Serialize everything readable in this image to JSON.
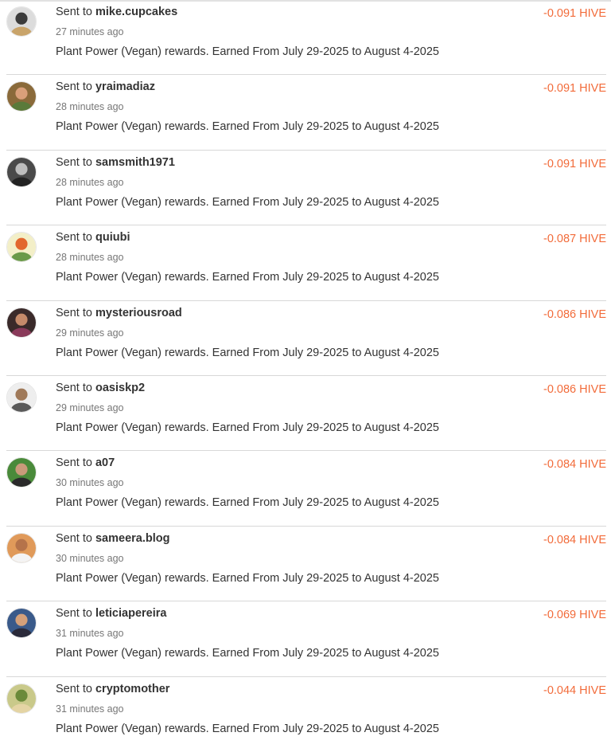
{
  "transactions": [
    {
      "sent_prefix": "Sent to",
      "recipient": "mike.cupcakes",
      "time_ago": "27 minutes ago",
      "memo": "Plant Power (Vegan) rewards. Earned From July 29-2025 to August 4-2025",
      "amount": "-0.091 HIVE",
      "avatar_colors": [
        "#dcdcdc",
        "#3b3b3b",
        "#c9a46a"
      ]
    },
    {
      "sent_prefix": "Sent to",
      "recipient": "yraimadiaz",
      "time_ago": "28 minutes ago",
      "memo": "Plant Power (Vegan) rewards. Earned From July 29-2025 to August 4-2025",
      "amount": "-0.091 HIVE",
      "avatar_colors": [
        "#8a6a3a",
        "#d9a07a",
        "#5a7a3a"
      ]
    },
    {
      "sent_prefix": "Sent to",
      "recipient": "samsmith1971",
      "time_ago": "28 minutes ago",
      "memo": "Plant Power (Vegan) rewards. Earned From July 29-2025 to August 4-2025",
      "amount": "-0.091 HIVE",
      "avatar_colors": [
        "#4a4a4a",
        "#bdbdbd",
        "#222222"
      ]
    },
    {
      "sent_prefix": "Sent to",
      "recipient": "quiubi",
      "time_ago": "28 minutes ago",
      "memo": "Plant Power (Vegan) rewards. Earned From July 29-2025 to August 4-2025",
      "amount": "-0.087 HIVE",
      "avatar_colors": [
        "#f3efc8",
        "#e2672e",
        "#6a9a4a"
      ]
    },
    {
      "sent_prefix": "Sent to",
      "recipient": "mysteriousroad",
      "time_ago": "29 minutes ago",
      "memo": "Plant Power (Vegan) rewards. Earned From July 29-2025 to August 4-2025",
      "amount": "-0.086 HIVE",
      "avatar_colors": [
        "#3a2a2a",
        "#c58a6a",
        "#8a3a5a"
      ]
    },
    {
      "sent_prefix": "Sent to",
      "recipient": "oasiskp2",
      "time_ago": "29 minutes ago",
      "memo": "Plant Power (Vegan) rewards. Earned From July 29-2025 to August 4-2025",
      "amount": "-0.086 HIVE",
      "avatar_colors": [
        "#eeeeee",
        "#a07a5a",
        "#5a5a5a"
      ]
    },
    {
      "sent_prefix": "Sent to",
      "recipient": "a07",
      "time_ago": "30 minutes ago",
      "memo": "Plant Power (Vegan) rewards. Earned From July 29-2025 to August 4-2025",
      "amount": "-0.084 HIVE",
      "avatar_colors": [
        "#4a8a3a",
        "#c99a7a",
        "#2a2a2a"
      ]
    },
    {
      "sent_prefix": "Sent to",
      "recipient": "sameera.blog",
      "time_ago": "30 minutes ago",
      "memo": "Plant Power (Vegan) rewards. Earned From July 29-2025 to August 4-2025",
      "amount": "-0.084 HIVE",
      "avatar_colors": [
        "#e09a5a",
        "#b5734a",
        "#f4f4f4"
      ]
    },
    {
      "sent_prefix": "Sent to",
      "recipient": "leticiapereira",
      "time_ago": "31 minutes ago",
      "memo": "Plant Power (Vegan) rewards. Earned From July 29-2025 to August 4-2025",
      "amount": "-0.069 HIVE",
      "avatar_colors": [
        "#3a5a8a",
        "#d4a07a",
        "#2a2a3a"
      ]
    },
    {
      "sent_prefix": "Sent to",
      "recipient": "cryptomother",
      "time_ago": "31 minutes ago",
      "memo": "Plant Power (Vegan) rewards. Earned From July 29-2025 to August 4-2025",
      "amount": "-0.044 HIVE",
      "avatar_colors": [
        "#c9c98a",
        "#6a8a3a",
        "#e4d4a4"
      ]
    }
  ],
  "accent_color": "#f26b3a"
}
